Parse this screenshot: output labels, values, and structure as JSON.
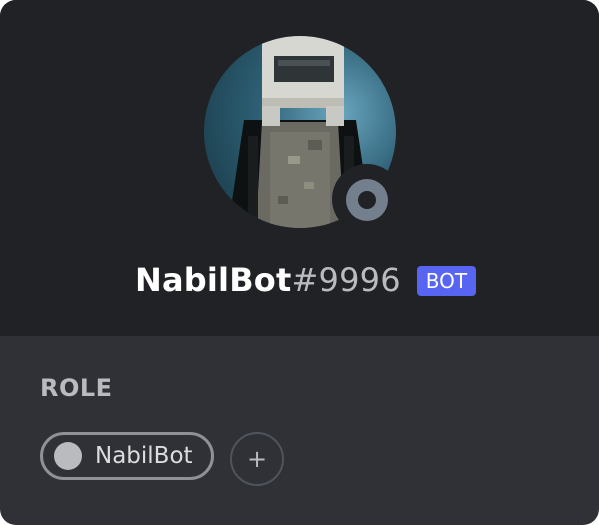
{
  "profile": {
    "username": "NabilBot",
    "discriminator": "#9996",
    "bot_tag": "BOT",
    "avatar_icon": "bot-avatar-icon",
    "status": "offline"
  },
  "roles_section": {
    "title": "ROLE",
    "roles": [
      {
        "name": "NabilBot",
        "color": "#b9bbbe"
      }
    ],
    "add_icon": "plus-icon",
    "add_symbol": "+"
  },
  "colors": {
    "header_bg": "#202225",
    "body_bg": "#2f3136",
    "bot_tag_bg": "#5865f2",
    "status_offline": "#747f8d"
  }
}
